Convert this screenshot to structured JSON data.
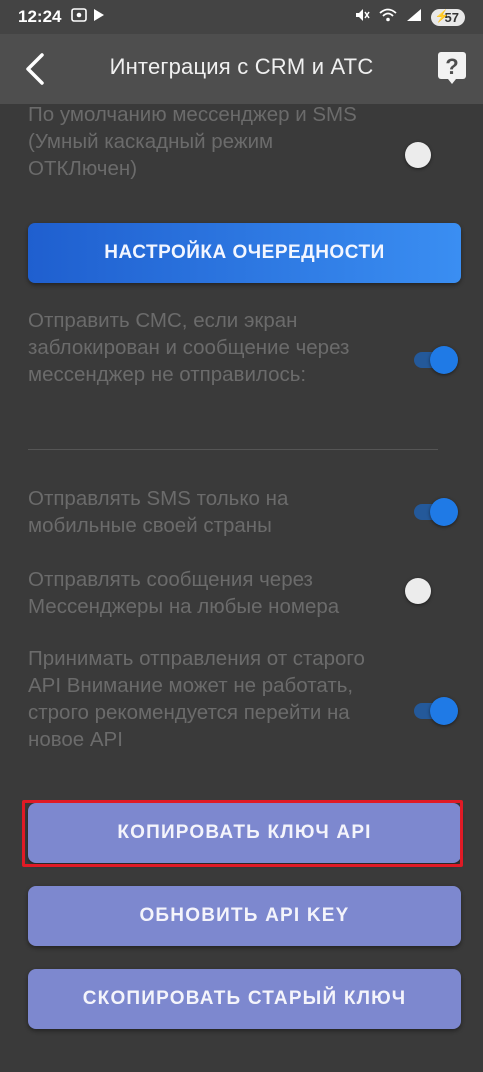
{
  "status_bar": {
    "time": "12:24",
    "battery": "57",
    "icons": [
      "screenshot-icon",
      "play-icon",
      "mute-icon",
      "wifi-icon",
      "signal-icon",
      "battery-icon"
    ]
  },
  "app_bar": {
    "title": "Интеграция с CRM и АТС",
    "back_icon": "back-arrow-icon",
    "help_icon": "help-icon"
  },
  "settings": {
    "default_messenger": {
      "text": "По умолчанию мессенджер и SMS (Умный каскадный режим ОТКЛючен)",
      "enabled": false
    },
    "queue_button": "НАСТРОЙКА ОЧЕРЕДНОСТИ",
    "sms_if_locked": {
      "text": "Отправить СМС, если экран заблокирован и сообщение через мессенджер не отправилось:",
      "enabled": true
    },
    "sms_own_country": {
      "text": "Отправлять SMS только на мобильные своей страны",
      "enabled": true
    },
    "messengers_any_number": {
      "text": "Отправлять сообщения через Мессенджеры на любые номера",
      "enabled": false
    },
    "old_api": {
      "text": "Принимать отправления от старого API Внимание может не работать, строго рекомендуется перейти на новое API",
      "enabled": true
    }
  },
  "buttons": {
    "copy_api_key": "КОПИРОВАТЬ КЛЮЧ API",
    "refresh_api_key": "ОБНОВИТЬ API KEY",
    "copy_old_key": "СКОПИРОВАТЬ СТАРЫЙ КЛЮЧ"
  },
  "colors": {
    "background": "#3a3a3a",
    "app_bar": "#4e4e4e",
    "accent_blue": "#1f7ae6",
    "button_purple": "#7d88cf",
    "highlight_red": "#e01a25"
  }
}
